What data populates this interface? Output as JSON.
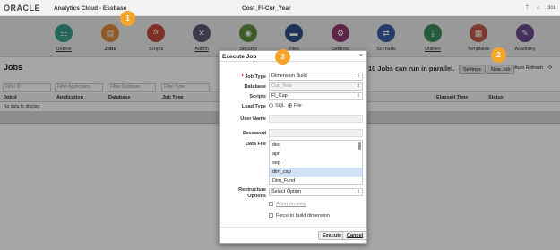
{
  "topbar": {
    "logo": "ORACLE",
    "app_name": "Analytics Cloud - Essbase",
    "page_title": "Cost_FI-Cur_Year",
    "icons": [
      "up-arrow-icon",
      "home-icon"
    ],
    "user": "clou"
  },
  "nav": [
    {
      "label": "Outline",
      "icon": "outline-icon",
      "color": "#3aa089",
      "glyph": "⚏"
    },
    {
      "label": "Jobs",
      "icon": "jobs-icon",
      "color": "#d98a3a",
      "glyph": "▤"
    },
    {
      "label": "Scripts",
      "icon": "scripts-icon",
      "color": "#c24a3b",
      "glyph": "fx"
    },
    {
      "label": "Admin",
      "icon": "admin-icon",
      "color": "#5a5a72",
      "glyph": "✕"
    },
    {
      "label": "Security",
      "icon": "security-icon",
      "color": "#5f8f3e",
      "glyph": "◉"
    },
    {
      "label": "Files",
      "icon": "files-icon",
      "color": "#2d4f8a",
      "glyph": "▬"
    },
    {
      "label": "Settings",
      "icon": "settings-icon",
      "color": "#8e3a6f",
      "glyph": "⚙"
    },
    {
      "label": "Scenario",
      "icon": "scenario-icon",
      "color": "#3b5fa6",
      "glyph": "⇄"
    },
    {
      "label": "Utilities",
      "icon": "utilities-icon",
      "color": "#3a8a5f",
      "glyph": "⤓"
    },
    {
      "label": "Templates",
      "icon": "templates-icon",
      "color": "#c05a4a",
      "glyph": "▦"
    },
    {
      "label": "Academy",
      "icon": "academy-icon",
      "color": "#6a4a8e",
      "glyph": "✎"
    }
  ],
  "badges": {
    "one": "1",
    "two": "2",
    "three": "3"
  },
  "jobs": {
    "title": "Jobs",
    "parallel_text": "10 Jobs can run in parallel.",
    "settings_btn": "Settings",
    "new_job_btn": "New Job",
    "auto_refresh": "Auto Refresh",
    "filters": [
      "Filter ID",
      "Filter Application",
      "Filter Database",
      "Filter Type"
    ],
    "columns": [
      "Jobid",
      "Application",
      "Database",
      "Job Type",
      "Elapsed Time",
      "Status"
    ],
    "empty": "No data to display."
  },
  "dialog": {
    "title": "Execute Job",
    "close": "×",
    "job_type_label": "Job Type",
    "job_type_value": "Dimension Build",
    "database_label": "Database",
    "database_value": "Cur_Year",
    "scripts_label": "Scripts",
    "scripts_value": "Fl_Cap",
    "load_type_label": "Load Type",
    "load_sql": "SQL",
    "load_file": "File",
    "user_label": "User Name",
    "password_label": "Password",
    "data_file_label": "Data File",
    "data_files": [
      "dec",
      "apr",
      "sep",
      "dim_cap",
      "Dim_Fund"
    ],
    "selected_file": "dim_cap",
    "restructure_label": "Restructure",
    "restructure_label2": "Options",
    "restructure_value": "Select Option",
    "abort_label": "Abort on error",
    "force_label": "Force to build dimension",
    "execute_btn": "Execute",
    "cancel_btn": "Cancel"
  }
}
